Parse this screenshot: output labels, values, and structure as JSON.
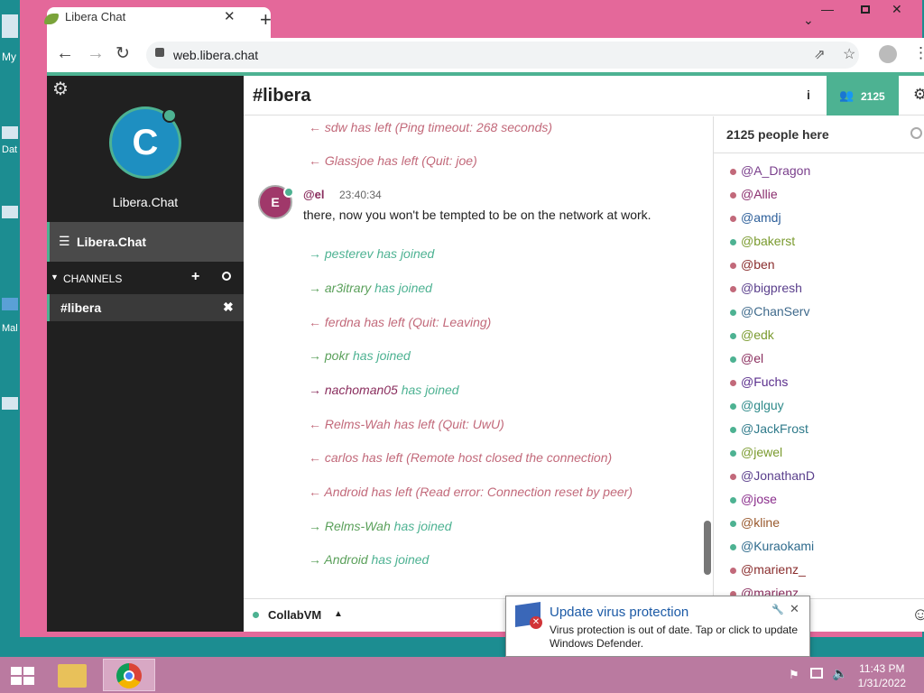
{
  "browser": {
    "tab_title": "Libera Chat",
    "url": "web.libera.chat"
  },
  "desktop": {
    "icons": [
      "My",
      "Dat",
      "",
      "Mal",
      ""
    ]
  },
  "sidebar": {
    "avatar_letter": "C",
    "network_name": "Libera.Chat",
    "network_item": "Libera.Chat",
    "channels_header": "CHANNELS",
    "channel_item": "#libera"
  },
  "header": {
    "channel_title": "#libera",
    "user_count": "2125"
  },
  "messages": [
    {
      "type": "part",
      "text": "← sdw has left (Ping timeout: 268 seconds)"
    },
    {
      "type": "part",
      "text": "← Glassjoe has left (Quit: joe)"
    },
    {
      "type": "msg",
      "avatar": "E",
      "nick": "@el",
      "time": "23:40:34",
      "text": "there, now you won't be tempted to be on the network at work."
    },
    {
      "type": "join",
      "nick": "→ pesterev",
      "text": " has joined"
    },
    {
      "type": "join",
      "nick": "→ ar3itrary",
      "text": " has joined"
    },
    {
      "type": "part",
      "text": "← ferdna has left (Quit: Leaving)"
    },
    {
      "type": "join",
      "nick": "→ pokr",
      "text": " has joined"
    },
    {
      "type": "join",
      "nick": "→ nachoman05",
      "text": " has joined"
    },
    {
      "type": "part",
      "text": "← Relms-Wah has left (Quit: UwU)"
    },
    {
      "type": "part",
      "text": "← carlos has left (Remote host closed the connection)"
    },
    {
      "type": "part",
      "text": "← Android has left (Read error: Connection reset by peer)"
    },
    {
      "type": "join",
      "nick": "→ Relms-Wah",
      "text": " has joined"
    },
    {
      "type": "join",
      "nick": "→ Android",
      "text": " has joined"
    }
  ],
  "userlist": {
    "header": "2125 people here",
    "users": [
      {
        "name": "@A_Dragon",
        "color": "#7a3f8c",
        "dot": "#c2697a"
      },
      {
        "name": "@Allie",
        "color": "#8a2e6e",
        "dot": "#c2697a"
      },
      {
        "name": "@amdj",
        "color": "#2d5f9a",
        "dot": "#c2697a"
      },
      {
        "name": "@bakerst",
        "color": "#7a9a2e",
        "dot": "#4db292"
      },
      {
        "name": "@ben",
        "color": "#8a2e2e",
        "dot": "#c2697a"
      },
      {
        "name": "@bigpresh",
        "color": "#5a3f8c",
        "dot": "#c2697a"
      },
      {
        "name": "@ChanServ",
        "color": "#3f6a8c",
        "dot": "#4db292"
      },
      {
        "name": "@edk",
        "color": "#7a9a2e",
        "dot": "#4db292"
      },
      {
        "name": "@el",
        "color": "#8a2e5e",
        "dot": "#4db292"
      },
      {
        "name": "@Fuchs",
        "color": "#5a2e8c",
        "dot": "#c2697a"
      },
      {
        "name": "@glguy",
        "color": "#2e8a8a",
        "dot": "#4db292"
      },
      {
        "name": "@JackFrost",
        "color": "#2e7a8a",
        "dot": "#4db292"
      },
      {
        "name": "@jewel",
        "color": "#7a9a2e",
        "dot": "#4db292"
      },
      {
        "name": "@JonathanD",
        "color": "#5a3f8c",
        "dot": "#c2697a"
      },
      {
        "name": "@jose",
        "color": "#8a2e8c",
        "dot": "#4db292"
      },
      {
        "name": "@kline",
        "color": "#9a5a2e",
        "dot": "#4db292"
      },
      {
        "name": "@Kuraokami",
        "color": "#2e6a8c",
        "dot": "#4db292"
      },
      {
        "name": "@marienz_",
        "color": "#8a2e2e",
        "dot": "#c2697a"
      },
      {
        "name": "@marienz",
        "color": "#8a2e5e",
        "dot": "#c2697a"
      }
    ]
  },
  "bottom": {
    "network_label": "CollabVM"
  },
  "notification": {
    "title": "Update virus protection",
    "text": "Virus protection is out of date. Tap or click to update Windows Defender."
  },
  "taskbar": {
    "time": "11:43 PM",
    "date": "1/31/2022"
  },
  "colors": {
    "accent": "#4db292",
    "part": "#c2697a",
    "sidebar_bg": "#202020",
    "window_frame": "#e4689a"
  }
}
